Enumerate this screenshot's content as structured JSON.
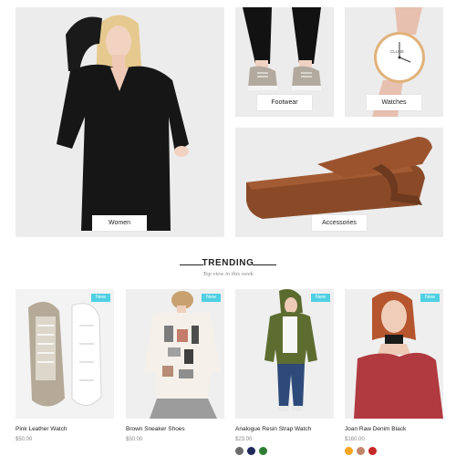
{
  "categories": {
    "women": {
      "label": "Women"
    },
    "footwear": {
      "label": "Footwear"
    },
    "watches": {
      "label": "Watches"
    },
    "accessories": {
      "label": "Accessories"
    },
    "watch_brand_text": "CLUSE"
  },
  "trending": {
    "title": "TRENDING",
    "subtitle": "Top view in this week"
  },
  "products": [
    {
      "name": "Pink Leather Watch",
      "price": "$50.00",
      "badge": "New",
      "swatches": []
    },
    {
      "name": "Brown Sneaker Shoes",
      "price": "$50.00",
      "badge": "New",
      "swatches": []
    },
    {
      "name": "Analogue Resin Strap Watch",
      "price": "$23.00",
      "badge": "New",
      "swatches": [
        "#6b6b6b",
        "#1f2a5c",
        "#2e7d32"
      ]
    },
    {
      "name": "Joan Raw Denim Black",
      "price": "$160.00",
      "badge": "New",
      "swatches": [
        "#f5a623",
        "#c1856a",
        "#c62828"
      ]
    }
  ],
  "colors": {
    "badge": "#4fd0e2",
    "tile_bg": "#ededed"
  }
}
